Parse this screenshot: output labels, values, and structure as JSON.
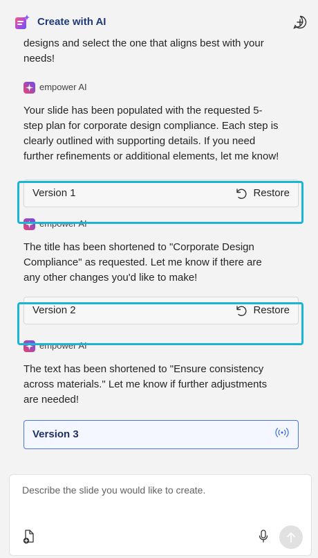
{
  "header": {
    "title": "Create with AI",
    "logo_icon": "sparkle-document-icon",
    "new_chat_icon": "add-chat-icon"
  },
  "messages": {
    "intro_text": "designs and select the one that aligns best with your needs!",
    "blocks": [
      {
        "ai_label": "empower AI",
        "text": "Your slide has been populated with the requested 5-step plan for corporate design compliance. Each step is clearly outlined with supporting details. If you need further refinements or additional elements, let me know!",
        "version_label": "Version 1",
        "restore_label": "Restore"
      },
      {
        "ai_label": "empower AI",
        "text": "The title has been shortened to \"Corporate Design Compliance\" as requested. Let me know if there are any other changes you'd like to make!",
        "version_label": "Version 2",
        "restore_label": "Restore"
      },
      {
        "ai_label": "empower AI",
        "text": "The text has been shortened to \"Ensure consistency across materials.\" Let me know if further adjustments are needed!",
        "version_label": "Version 3",
        "status_icon": "broadcast-icon"
      }
    ]
  },
  "composer": {
    "placeholder": "Describe the slide you would like to create.",
    "attach_icon": "attach-file-icon",
    "mic_icon": "microphone-icon",
    "send_icon": "arrow-up-icon"
  },
  "colors": {
    "highlight": "#1bb4d5",
    "title": "#1d3a7a",
    "active_border": "#4a78d6"
  }
}
